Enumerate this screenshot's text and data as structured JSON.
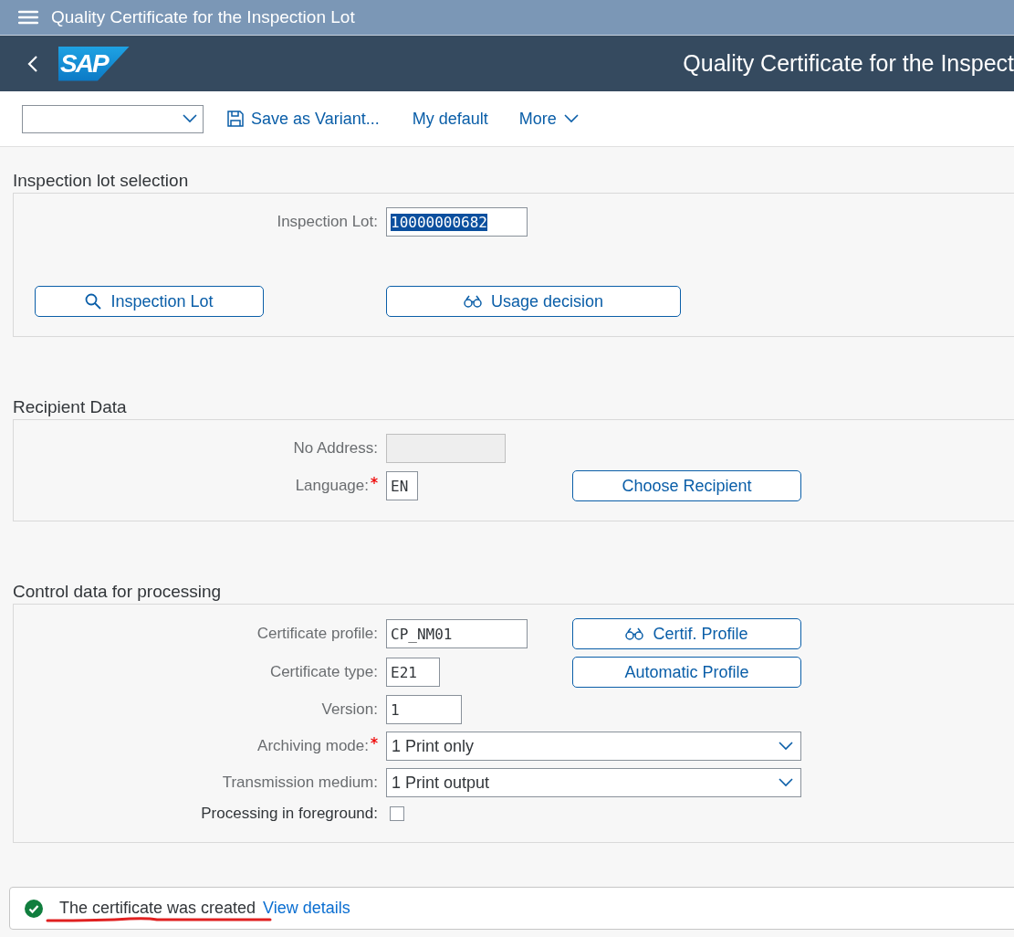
{
  "shell": {
    "title": "Quality Certificate for the Inspection Lot"
  },
  "header": {
    "logo": "SAP",
    "title": "Quality Certificate for the Inspect"
  },
  "toolbar": {
    "items": [
      {
        "kind": "save",
        "label": "Save as Variant..."
      },
      {
        "kind": "plain",
        "label": "My default"
      },
      {
        "kind": "menu",
        "label": "More"
      }
    ]
  },
  "sections": [
    {
      "title": "Inspection lot selection",
      "rows": [
        {
          "kind": "field",
          "label": "Inspection Lot:",
          "value": "10000000682",
          "highlighted": true,
          "required": false,
          "disabled": false
        },
        {
          "kind": "buttons",
          "buttons": [
            {
              "label": "Inspection Lot"
            },
            {
              "label": "Usage decision"
            }
          ]
        }
      ]
    },
    {
      "title": "Recipient Data",
      "rows": [
        {
          "kind": "field",
          "label": "No Address:",
          "required": false,
          "disabled": true
        },
        {
          "kind": "field",
          "label": "Language:",
          "value": "EN",
          "highlighted": false,
          "required": true,
          "disabled": false,
          "button": {
            "label": "Choose Recipient"
          }
        }
      ]
    },
    {
      "title": "Control data for processing",
      "rows": [
        {
          "kind": "field",
          "label": "Certificate profile:",
          "value": "CP_NM01",
          "highlighted": false,
          "required": false,
          "disabled": false,
          "button": {
            "label": "Certif. Profile"
          }
        },
        {
          "kind": "field",
          "label": "Certificate type:",
          "value": "E21",
          "highlighted": false,
          "required": false,
          "disabled": false,
          "button": {
            "label": "Automatic Profile"
          }
        },
        {
          "kind": "field",
          "label": "Version:",
          "value": "1",
          "highlighted": false,
          "required": false,
          "disabled": false
        },
        {
          "kind": "dropdown",
          "label": "Archiving mode:",
          "value": "1 Print only",
          "required": true
        },
        {
          "kind": "dropdown",
          "label": "Transmission medium:",
          "value": "1 Print output",
          "required": false
        },
        {
          "kind": "checkbox",
          "label": "Processing in foreground:",
          "checked": false
        }
      ]
    }
  ],
  "message": {
    "text": "The certificate was created",
    "link": "View details",
    "underlined": true
  }
}
